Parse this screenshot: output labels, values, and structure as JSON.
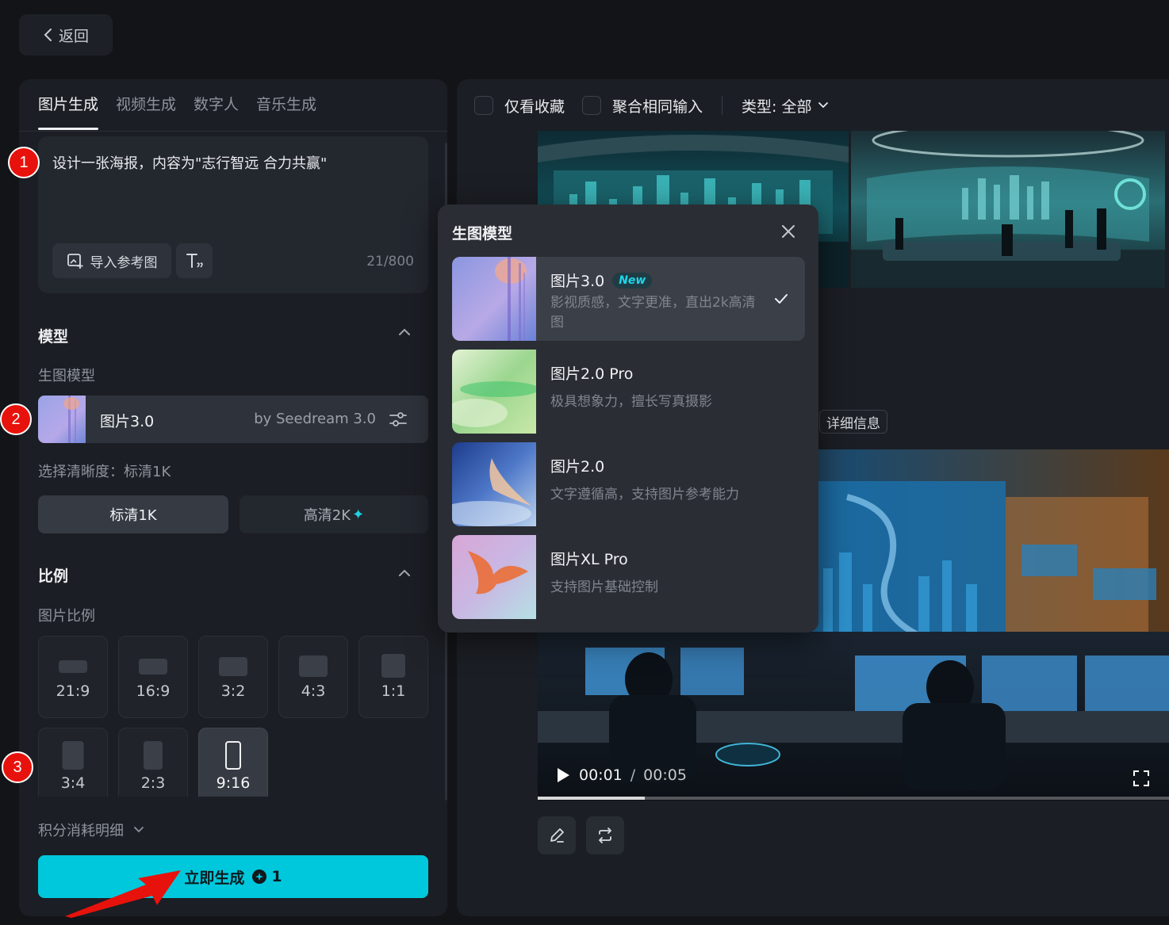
{
  "header": {
    "back_label": "返回"
  },
  "tabs": [
    {
      "label": "图片生成",
      "active": true
    },
    {
      "label": "视频生成",
      "active": false
    },
    {
      "label": "数字人",
      "active": false
    },
    {
      "label": "音乐生成",
      "active": false
    }
  ],
  "prompt": {
    "text": "设计一张海报，内容为\"志行智远 合力共赢\"",
    "import_label": "导入参考图",
    "char_count": "21/800"
  },
  "model_section": {
    "title": "模型",
    "sub_label": "生图模型",
    "selected_name": "图片3.0",
    "selected_by": "by Seedream 3.0"
  },
  "resolution": {
    "label": "选择清晰度：标清1K",
    "options": [
      "标清1K",
      "高清2K"
    ],
    "selected": "标清1K"
  },
  "ratio_section": {
    "title": "比例",
    "sub_label": "图片比例",
    "options": [
      "21:9",
      "16:9",
      "3:2",
      "4:3",
      "1:1",
      "3:4",
      "2:3",
      "9:16"
    ],
    "selected": "9:16"
  },
  "points_detail_label": "积分消耗明细",
  "generate": {
    "label": "立即生成",
    "cost": "1"
  },
  "filters": {
    "favorites_label": "仅看收藏",
    "merge_label": "聚合相同输入",
    "type_label": "类型: 全部"
  },
  "detail_info_label": "详细信息",
  "video": {
    "current_time": "00:01",
    "separator": "/",
    "duration": "00:05",
    "progress": 0.17
  },
  "dropdown": {
    "title": "生图模型",
    "options": [
      {
        "name": "图片3.0",
        "badge": "New",
        "desc": "影视质感，文字更准，直出2k高清图",
        "selected": true
      },
      {
        "name": "图片2.0 Pro",
        "desc": "极具想象力，擅长写真摄影",
        "selected": false
      },
      {
        "name": "图片2.0",
        "desc": "文字遵循高，支持图片参考能力",
        "selected": false
      },
      {
        "name": "图片XL Pro",
        "desc": "支持图片基础控制",
        "selected": false
      }
    ]
  },
  "annotations": [
    "1",
    "2",
    "3"
  ],
  "colors": {
    "accent": "#00c8dc",
    "marker": "#e8120c",
    "background": "#131417",
    "panel": "#1b1e24"
  }
}
